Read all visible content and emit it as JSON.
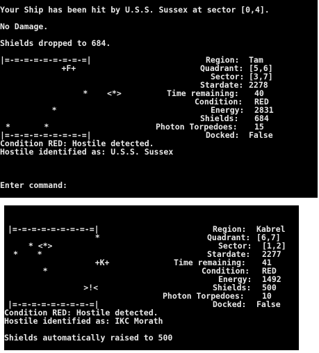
{
  "colors": {
    "terminal_bg": "#000000",
    "terminal_fg": "#e8e8e8",
    "page_bg": "#ffffff"
  },
  "screen1": {
    "messages": [
      "Your Ship has been hit by U.S.S. Sussex at sector [0,4].",
      "No Damage.",
      "Shields dropped to 684."
    ],
    "map_border": "|=-=-=-=-=-=-=-=-=|",
    "map_rows": [
      "       +F+",
      "",
      "        *    <*>",
      "     *",
      "*       *"
    ],
    "status_labels": [
      "Region:",
      "Quadrant:",
      "Sector:",
      "Stardate:",
      "Time remaining:",
      "Condition:",
      "Energy:",
      "Shields:",
      "Photon Torpedoes:",
      "Docked:"
    ],
    "status_values": [
      "Tam",
      "[5,6]",
      "[3,7]",
      "2278",
      "40",
      "RED",
      "2831",
      "684",
      "15",
      "False"
    ],
    "alerts": [
      "Condition RED: Hostile detected.",
      "Hostile identified as: U.S.S. Sussex"
    ],
    "prompt": "Enter command:"
  },
  "screen2": {
    "map_border": "|=-=-=-=-=-=-=-=-=|",
    "map_rows": [
      "                 *",
      "  * <*>",
      "*    *",
      "     *",
      "                 +K+",
      "",
      "          >!<"
    ],
    "status_labels": [
      "Region:",
      "Quadrant:",
      "Sector:",
      "Stardate:",
      "Time remaining:",
      "Condition:",
      "Energy:",
      "Shields:",
      "Photon Torpedoes:",
      "Docked:"
    ],
    "status_values": [
      "Kabrel",
      "[6,7]",
      "[1,2]",
      "2277",
      "41",
      "RED",
      "1492",
      "500",
      "10",
      "False"
    ],
    "alerts": [
      "Condition RED: Hostile detected.",
      "Hostile identified as: IKC Morath"
    ],
    "footer": "Shields automatically raised to 500"
  }
}
